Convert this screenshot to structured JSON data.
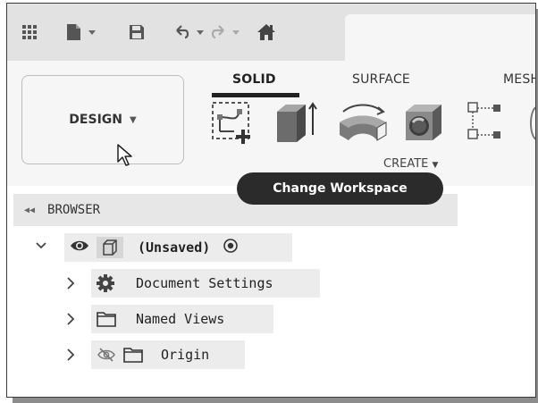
{
  "quick_access": {
    "icons": [
      "apps-grid-icon",
      "file-icon",
      "save-icon",
      "undo-icon",
      "redo-icon",
      "home-icon"
    ]
  },
  "ribbon": {
    "workspace_button_label": "DESIGN",
    "tabs": [
      "SOLID",
      "SURFACE",
      "MESH"
    ],
    "active_tab": "SOLID",
    "group_label": "CREATE",
    "tools": [
      "create-sketch-icon",
      "extrude-icon",
      "revolve-icon",
      "hole-icon",
      "pattern-icon"
    ]
  },
  "tooltip": {
    "text": "Change Workspace"
  },
  "browser": {
    "title": "BROWSER",
    "items": [
      {
        "label": "(Unsaved)",
        "expanded": true
      },
      {
        "label": "Document Settings",
        "expanded": false
      },
      {
        "label": "Named Views",
        "expanded": false
      },
      {
        "label": "Origin",
        "expanded": false
      }
    ]
  },
  "colors": {
    "toolbar_bg": "#e2e2e2",
    "ribbon_bg": "#f6f6f6",
    "tooltip_bg": "#2b2b2b",
    "active_tab_underline": "#222222"
  }
}
